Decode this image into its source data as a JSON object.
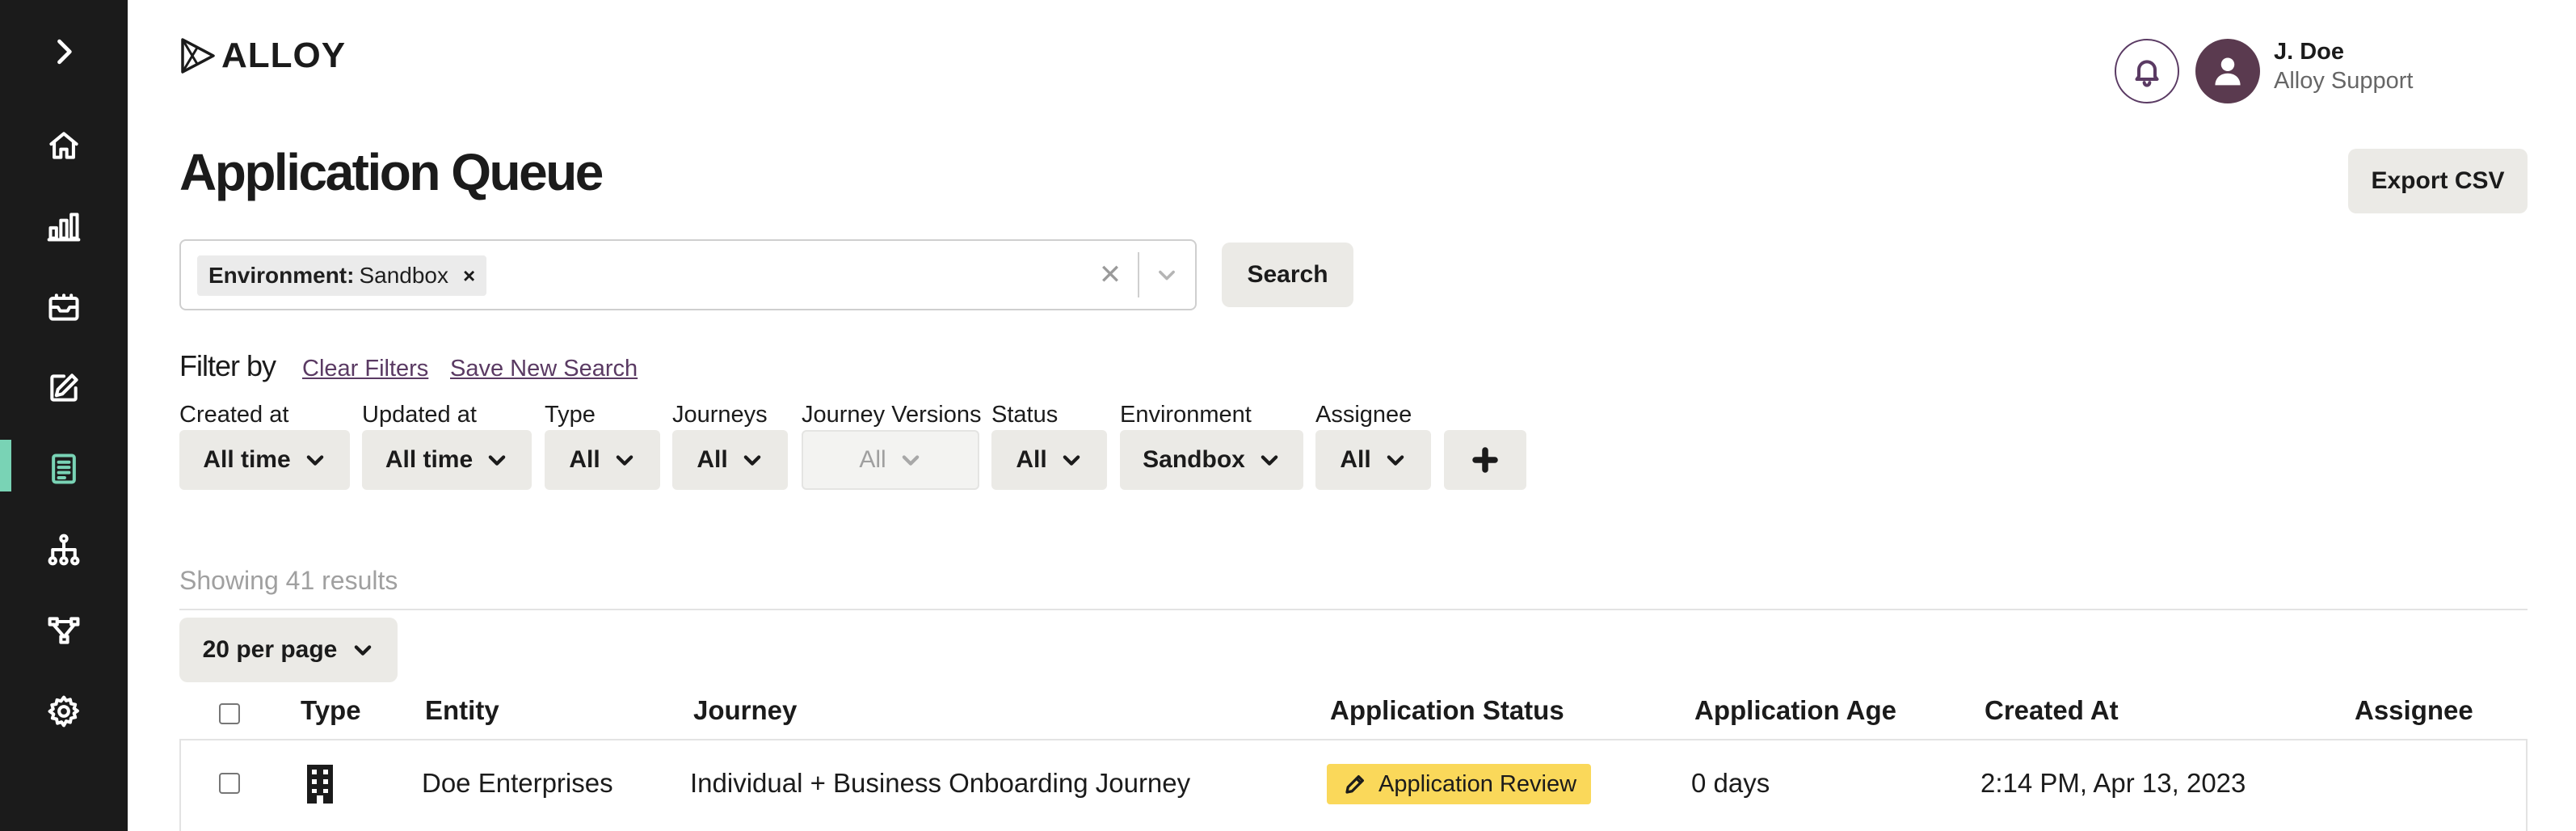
{
  "app": {
    "logo_text": "ALLOY",
    "accent_color": "#79d3b5",
    "brand_purple": "#5a3a63"
  },
  "sidebar": {
    "items": [
      {
        "name": "expand",
        "icon": "chevron-right-icon"
      },
      {
        "name": "home",
        "icon": "home-icon"
      },
      {
        "name": "analytics",
        "icon": "bar-chart-icon"
      },
      {
        "name": "inbox",
        "icon": "inbox-icon"
      },
      {
        "name": "edit",
        "icon": "edit-icon"
      },
      {
        "name": "applications",
        "icon": "document-list-icon",
        "active": true
      },
      {
        "name": "hierarchy",
        "icon": "hierarchy-icon"
      },
      {
        "name": "workflow",
        "icon": "workflow-icon"
      },
      {
        "name": "settings",
        "icon": "gear-icon"
      }
    ]
  },
  "header": {
    "user_name": "J. Doe",
    "user_org": "Alloy Support",
    "notifications_icon": "bell-icon",
    "avatar_icon": "user-icon"
  },
  "page": {
    "title": "Application Queue",
    "export_label": "Export CSV"
  },
  "search": {
    "chip_key": "Environment:",
    "chip_value": "Sandbox",
    "chip_remove": "×",
    "clear_symbol": "✕",
    "button_label": "Search"
  },
  "filters": {
    "heading": "Filter by",
    "clear_label": "Clear Filters",
    "save_label": "Save New Search",
    "items": [
      {
        "label": "Created at",
        "value": "All time"
      },
      {
        "label": "Updated at",
        "value": "All time"
      },
      {
        "label": "Type",
        "value": "All"
      },
      {
        "label": "Journeys",
        "value": "All"
      },
      {
        "label": "Journey Versions",
        "value": "All",
        "disabled": true
      },
      {
        "label": "Status",
        "value": "All"
      },
      {
        "label": "Environment",
        "value": "Sandbox"
      },
      {
        "label": "Assignee",
        "value": "All"
      }
    ],
    "add_icon": "plus-icon"
  },
  "results": {
    "count_text": "Showing 41 results",
    "per_page_label": "20 per page"
  },
  "table": {
    "columns": [
      "Type",
      "Entity",
      "Journey",
      "Application Status",
      "Application Age",
      "Created At",
      "Assignee"
    ],
    "rows": [
      {
        "type_icon": "building-icon",
        "entity": "Doe Enterprises",
        "journey": "Individual + Business Onboarding Journey",
        "status": "Application Review",
        "status_color": "#fad85a",
        "age": "0 days",
        "created_at": "2:14 PM, Apr 13, 2023",
        "assignee": ""
      }
    ]
  }
}
